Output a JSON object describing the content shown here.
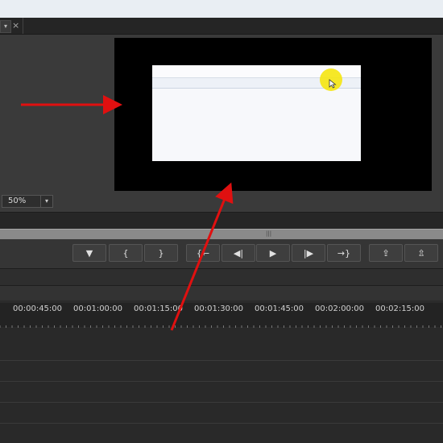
{
  "tab": {
    "close_glyph": "×",
    "dropdown_glyph": "▾"
  },
  "monitor": {
    "zoom": "50%",
    "zoom_arrow": "▾"
  },
  "transport": {
    "buttons": [
      {
        "id": "add-marker",
        "glyph": "▼"
      },
      {
        "id": "mark-in",
        "glyph": "{"
      },
      {
        "id": "mark-out",
        "glyph": "}"
      },
      {
        "id": "go-to-in",
        "glyph": "{←"
      },
      {
        "id": "step-back",
        "glyph": "◀|"
      },
      {
        "id": "play",
        "glyph": "▶"
      },
      {
        "id": "step-forward",
        "glyph": "|▶"
      },
      {
        "id": "go-to-out",
        "glyph": "→}"
      },
      {
        "id": "lift",
        "glyph": "⇪"
      },
      {
        "id": "extract",
        "glyph": "⇫"
      }
    ]
  },
  "timeline": {
    "timecodes": [
      "00:00:45:00",
      "00:01:00:00",
      "00:01:15:00",
      "00:01:30:00",
      "00:01:45:00",
      "00:02:00:00",
      "00:02:15:00"
    ]
  },
  "annotations": {
    "arrow_color": "#e01010",
    "highlight_color": "#f5e50f"
  }
}
